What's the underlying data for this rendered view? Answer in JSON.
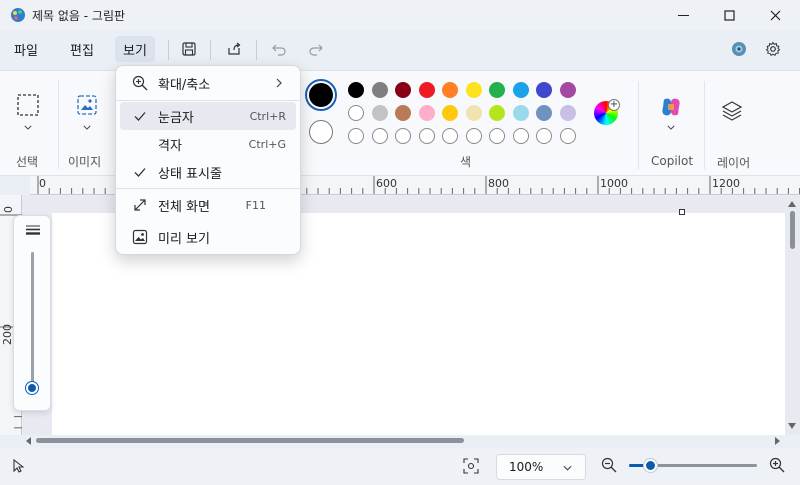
{
  "window": {
    "title": "제목 없음 - 그림판"
  },
  "menu": {
    "file": "파일",
    "edit": "편집",
    "view": "보기"
  },
  "ribbon": {
    "select_label": "선택",
    "image_label": "이미지",
    "color_label": "색",
    "copilot_label": "Copilot",
    "layers_label": "레이어"
  },
  "colors": {
    "row1": [
      "#000000",
      "#7f7f7f",
      "#880015",
      "#ed1c24",
      "#ff7f27",
      "#ffe21f",
      "#22b14c",
      "#1aa3e8",
      "#3f48cc",
      "#a349a4"
    ],
    "row2": [
      "#ffffff",
      "#c3c3c3",
      "#b97a57",
      "#ffaec9",
      "#ffc90e",
      "#efe4b0",
      "#b5e61d",
      "#99d9ea",
      "#7092be",
      "#c8bfe7"
    ],
    "primary": "#000000",
    "secondary": "#ffffff"
  },
  "ruler": {
    "h_labels": [
      "0",
      "600",
      "800",
      "1000",
      "1200"
    ],
    "v_labels": [
      "0",
      "200"
    ]
  },
  "view_menu": {
    "zoom": "확대/축소",
    "ruler": "눈금자",
    "ruler_shortcut": "Ctrl+R",
    "grid": "격자",
    "grid_shortcut": "Ctrl+G",
    "statusbar": "상태 표시줄",
    "fullscreen": "전체 화면",
    "fullscreen_shortcut": "F11",
    "preview": "미리 보기"
  },
  "status": {
    "zoom_level": "100%"
  }
}
